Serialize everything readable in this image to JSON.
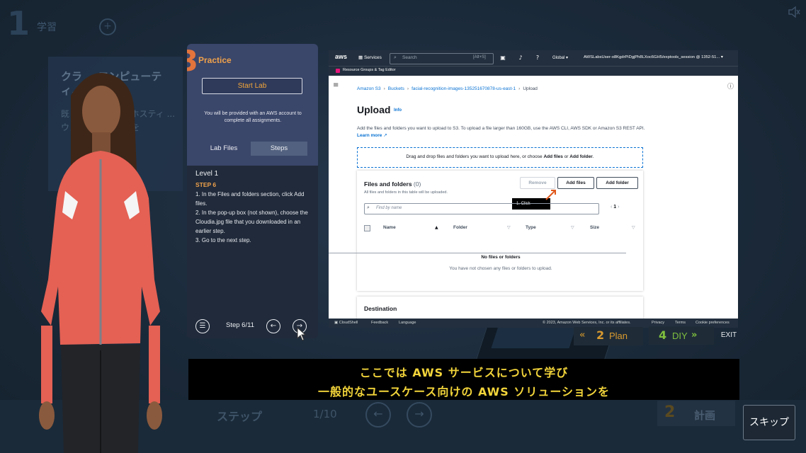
{
  "background": {
    "step_number": "1",
    "title": "学習",
    "card_title": "クラ ...コンピューティ...本",
    "card_body": "既 ...イトを A...的ホスティ ...ウェブア ...信頼性を",
    "bottom_step_label": "ステップ",
    "bottom_step_count": "1/10",
    "bottom_plan_number": "2",
    "bottom_plan_label": "計画"
  },
  "lab_panel": {
    "practice_number": "3",
    "practice_label": "Practice",
    "start_lab_label": "Start Lab",
    "info_text": "You will be provided with an AWS account to complete all assignments.",
    "tabs": [
      {
        "label": "Lab Files",
        "active": false
      },
      {
        "label": "Steps",
        "active": true
      }
    ],
    "level": "Level 1",
    "step_heading": "STEP 6",
    "step_lines": [
      "1. In the Files and folders section, click Add files.",
      "2. In the pop-up box (not shown), choose the Cloudia.jpg file that you downloaded in an earlier step.",
      "3. Go to the next step."
    ],
    "step_counter": "Step 6/11"
  },
  "console": {
    "nav": {
      "logo": "aws",
      "services": "Services",
      "search_placeholder": "Search",
      "search_hint": "[Alt+S]",
      "region": "Global ▾",
      "account": "AWSLabsUser-o8KgdrPiDgjPh8LXoc6GH5/exptools_session @ 1352-51... ▾"
    },
    "resource_groups": "Resource Groups & Tag Editor",
    "breadcrumb": [
      "Amazon S3",
      "Buckets",
      "facial-recognition-images-135251670878-us-east-1",
      "Upload"
    ],
    "page_title": "Upload",
    "info_link": "Info",
    "description": "Add the files and folders you want to upload to S3. To upload a file larger than 160GB, use the AWS CLI, AWS SDK or Amazon S3 REST API.",
    "learn_more": "Learn more",
    "dropzone_text_1": "Drag and drop files and folders you want to upload here, or choose ",
    "dropzone_bold_1": "Add files",
    "dropzone_text_2": " or ",
    "dropzone_bold_2": "Add folder",
    "dropzone_text_3": ".",
    "files_panel": {
      "title": "Files and folders",
      "count": "(0)",
      "subtitle": "All files and folders in this table will be uploaded.",
      "remove_label": "Remove",
      "add_files_label": "Add files",
      "add_folder_label": "Add folder",
      "tooltip": "1. Click",
      "find_placeholder": "Find by name",
      "page": "1",
      "columns": [
        "Name",
        "Folder",
        "Type",
        "Size"
      ],
      "empty_title": "No files or folders",
      "empty_subtitle": "You have not chosen any files or folders to upload."
    },
    "destination_title": "Destination",
    "footer": {
      "cloudshell": "CloudShell",
      "feedback": "Feedback",
      "language": "Language",
      "copyright": "© 2023, Amazon Web Services, Inc. or its affiliates.",
      "privacy": "Privacy",
      "terms": "Terms",
      "cookies": "Cookie preferences"
    }
  },
  "stage_nav": {
    "plan_number": "2",
    "plan_label": "Plan",
    "diy_number": "4",
    "diy_label": "DIY",
    "exit_label": "EXIT"
  },
  "subtitles": {
    "line1": "ここでは AWS サービスについて学び",
    "line2": "一般的なユースケース向けの AWS ソリューションを"
  },
  "skip_label": "スキップ",
  "colors": {
    "accent_orange": "#f0a24b",
    "aws_blue": "#0972d3",
    "aws_nav": "#232f3e",
    "subtitle_yellow": "#f2d43a",
    "diy_green": "#7fbf3e"
  }
}
